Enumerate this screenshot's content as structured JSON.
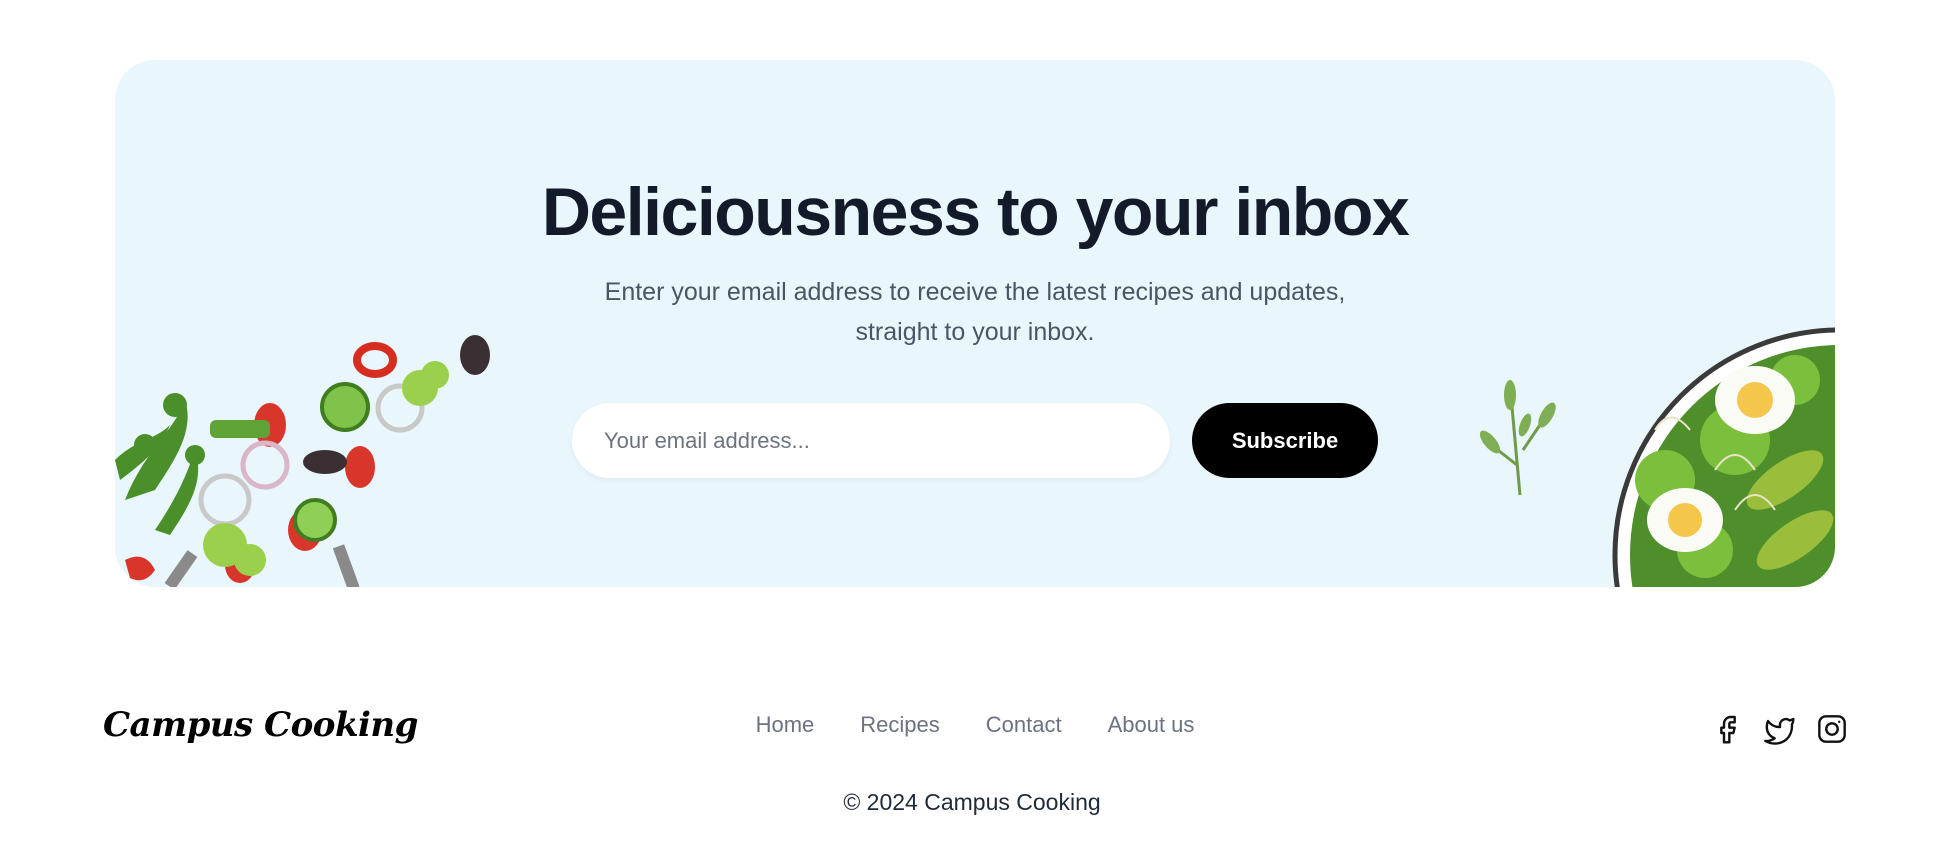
{
  "newsletter": {
    "title": "Deliciousness to your inbox",
    "subtitle": "Enter your email address to receive the latest recipes and updates, straight to your inbox.",
    "email_placeholder": "Your email address...",
    "subscribe_label": "Subscribe"
  },
  "footer": {
    "logo": "Campus Cooking",
    "nav": [
      "Home",
      "Recipes",
      "Contact",
      "About us"
    ],
    "social_icons": [
      "facebook-icon",
      "twitter-icon",
      "instagram-icon"
    ],
    "copyright": "© 2024 Campus Cooking"
  },
  "colors": {
    "banner_bg": "#e9f6fb",
    "button_bg": "#000000",
    "heading": "#131a2a"
  }
}
